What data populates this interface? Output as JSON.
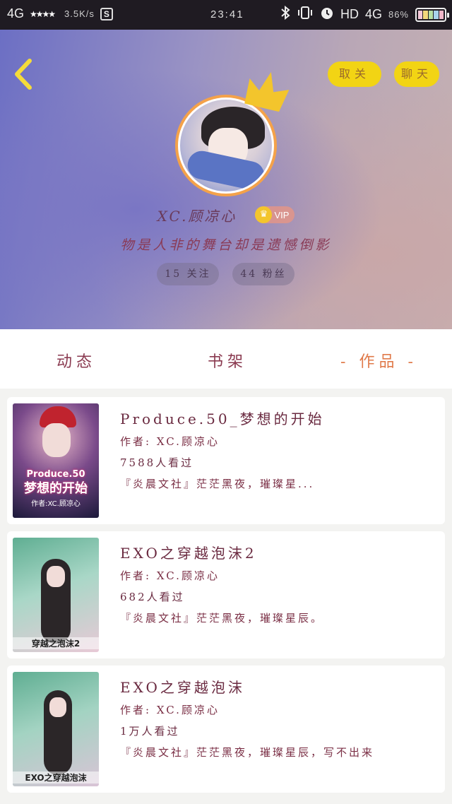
{
  "status_bar": {
    "network_left": "4G",
    "speed": "3.5K/s",
    "s_icon": "S",
    "time": "23:41",
    "network_right": "4G",
    "hd": "HD",
    "battery_pct": "86%",
    "icons": [
      "signal-icon",
      "bluetooth-icon",
      "vibrate-icon",
      "alarm-icon",
      "battery-icon"
    ]
  },
  "header": {
    "back_icon": "chevron-left-icon",
    "unfollow_label": "取关",
    "chat_label": "聊天",
    "username": "XC.顾凉心",
    "vip_label": "VIP",
    "signature": "物是人非的舞台却是遗憾倒影",
    "following_label": "15 关注",
    "fans_label": "44 粉丝"
  },
  "tabs": [
    {
      "label": "动态"
    },
    {
      "label": "书架"
    },
    {
      "label": "作品",
      "active": true
    }
  ],
  "books": [
    {
      "title": "Produce.50_梦想的开始",
      "author": "作者: XC.顾凉心",
      "views": "7588人看过",
      "desc": "『炎晨文社』茫茫黑夜，璀璨星...",
      "cover_title": "Produce.50",
      "cover_title2": "梦想的开始",
      "cover_sub": "作者:XC.顾凉心",
      "cover_colors": [
        "#1c1a3a",
        "#4a3a7a",
        "#c23a5a"
      ]
    },
    {
      "title": "EXO之穿越泡沫2",
      "author": "作者: XC.顾凉心",
      "views": "682人看过",
      "desc": "『炎晨文社』茫茫黑夜，璀璨星辰。",
      "cover_caption": "穿越之泡沫2",
      "cover_colors": [
        "#6fb59a",
        "#a4d4c4",
        "#e6c7d4"
      ]
    },
    {
      "title": "EXO之穿越泡沫",
      "author": "作者: XC.顾凉心",
      "views": "1万人看过",
      "desc": "『炎晨文社』茫茫黑夜，璀璨星辰，写不出来",
      "cover_caption": "EXO之穿越泡沫",
      "cover_colors": [
        "#6fb59a",
        "#9fd1bf",
        "#d9c4d6"
      ]
    }
  ],
  "colors": {
    "accent_yellow": "#f2d414",
    "active_tab": "#e07a4a",
    "text_wine": "#7a2e44"
  }
}
